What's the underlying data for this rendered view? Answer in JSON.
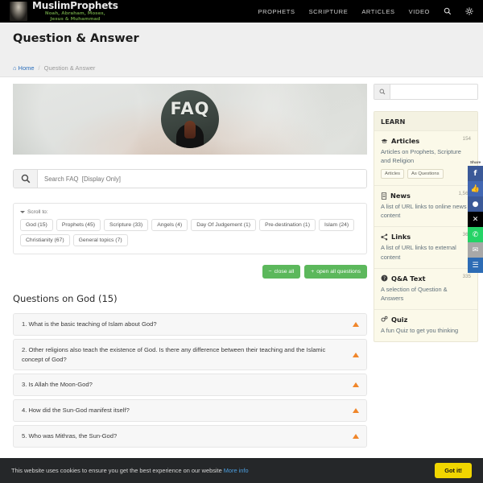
{
  "header": {
    "brand_title": "MuslimProphets",
    "brand_subtitle": "Noah, Abraham, Moses,\nJesus & Muhammad",
    "nav": [
      {
        "label": "PROPHETS"
      },
      {
        "label": "SCRIPTURE"
      },
      {
        "label": "ARTICLES"
      },
      {
        "label": "VIDEO"
      }
    ],
    "search_icon": "search-icon",
    "settings_icon": "gear-icon"
  },
  "page": {
    "title": "Question & Answer",
    "breadcrumb": {
      "home": "Home",
      "separator": "/",
      "current": "Question & Answer"
    }
  },
  "hero": {
    "label": "FAQ"
  },
  "faq_search": {
    "placeholder": "Search FAQ  [Display Only]",
    "value": "",
    "icon": "search-icon"
  },
  "scroll_to": {
    "label": "Scroll to:",
    "chips": [
      "God (15)",
      "Prophets (45)",
      "Scripture (33)",
      "Angels (4)",
      "Day Of Judgement (1)",
      "Pre-destination (1)",
      "Islam (24)",
      "Christianity (67)",
      "General topics (7)"
    ]
  },
  "actions": {
    "close_all": "close all",
    "close_all_sign": "−",
    "open_all": "open all questions",
    "open_all_sign": "+",
    "accent_color": "#5cb85c"
  },
  "questions": {
    "section_title": "Questions on God (15)",
    "items": [
      {
        "text": "1. What is the basic teaching of Islam about God?"
      },
      {
        "text": "2. Other religions also teach the existence of God. Is there any difference between their teaching and the Islamic concept of God?"
      },
      {
        "text": "3. Is Allah the Moon-God?"
      },
      {
        "text": "4. How did the Sun-God manifest itself?"
      },
      {
        "text": "5. Who was Mithras, the Sun-God?"
      }
    ],
    "arrow_color": "#f0862a"
  },
  "sidebar": {
    "search": {
      "placeholder": "",
      "value": "",
      "icon": "search-icon"
    },
    "learn_heading": "LEARN",
    "items": [
      {
        "name": "Articles",
        "icon": "graduation-cap-icon",
        "count": "154",
        "description": "Articles on Prophets, Scripture and Religion",
        "tags": [
          "Articles",
          "As Questions"
        ]
      },
      {
        "name": "News",
        "icon": "file-icon",
        "count": "1,564",
        "description": "A list of URL links to online news content",
        "tags": []
      },
      {
        "name": "Links",
        "icon": "share-nodes-icon",
        "count": "364",
        "description": "A list of URL links to external content",
        "tags": []
      },
      {
        "name": "Q&A Text",
        "icon": "question-circle-icon",
        "count": "335",
        "description": "A selection of Question & Answers",
        "tags": []
      },
      {
        "name": "Quiz",
        "icon": "cogs-icon",
        "count": "",
        "description": "A fun Quiz to get you thinking",
        "tags": []
      }
    ]
  },
  "share_rail": {
    "label": "Share",
    "buttons": [
      {
        "name": "facebook-share-button",
        "glyph": "f",
        "color": "#3b5998"
      },
      {
        "name": "facebook-like-button",
        "glyph": "👍",
        "color": "#4267b2"
      },
      {
        "name": "messenger-share-button",
        "glyph": "●",
        "color": "#3b5998"
      },
      {
        "name": "x-twitter-share-button",
        "glyph": "✕",
        "color": "#000000"
      },
      {
        "name": "whatsapp-share-button",
        "glyph": "✆",
        "color": "#25d366"
      },
      {
        "name": "email-share-button",
        "glyph": "✉",
        "color": "#a8a8a8"
      },
      {
        "name": "more-share-button",
        "glyph": "☰",
        "color": "#2d6cb5"
      }
    ]
  },
  "cookie_bar": {
    "text": "This website uses cookies to ensure you get the best experience on our website",
    "link": "More info",
    "button": "Got it!",
    "button_color": "#f1d600"
  }
}
